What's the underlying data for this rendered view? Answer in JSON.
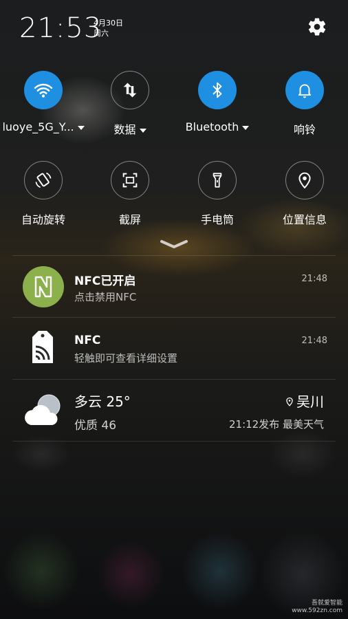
{
  "status_bar": {
    "time": "21:53",
    "date": "4月30日",
    "weekday": "周六"
  },
  "quick_settings": {
    "row1": [
      {
        "label": "luoye_5G_Y...",
        "icon": "wifi-icon",
        "active": true,
        "has_dropdown": true
      },
      {
        "label": "数据",
        "icon": "mobile-data-icon",
        "active": false,
        "has_dropdown": true
      },
      {
        "label": "Bluetooth",
        "icon": "bluetooth-icon",
        "active": true,
        "has_dropdown": true
      },
      {
        "label": "响铃",
        "icon": "bell-icon",
        "active": true,
        "has_dropdown": false
      }
    ],
    "row2": [
      {
        "label": "自动旋转",
        "icon": "auto-rotate-icon",
        "active": false
      },
      {
        "label": "截屏",
        "icon": "screenshot-icon",
        "active": false
      },
      {
        "label": "手电筒",
        "icon": "flashlight-icon",
        "active": false
      },
      {
        "label": "位置信息",
        "icon": "location-icon",
        "active": false
      }
    ]
  },
  "notifications": [
    {
      "title": "NFC已开启",
      "subtitle": "点击禁用NFC",
      "time": "21:48",
      "icon": "nfc-logo-icon"
    },
    {
      "title": "NFC",
      "subtitle": "轻触即可查看详细设置",
      "time": "21:48",
      "icon": "nfc-tag-icon"
    }
  ],
  "weather": {
    "condition_temp": "多云 25°",
    "air_quality": "优质 46",
    "location": "吴川",
    "published": "21:12发布 最美天气",
    "icon": "cloudy-icon"
  },
  "watermark": {
    "line1": "吾就爱智能",
    "line2": "www.592zn.com"
  },
  "colors": {
    "active": "#1e8fe1",
    "nfc_green": "#8bb04c"
  }
}
